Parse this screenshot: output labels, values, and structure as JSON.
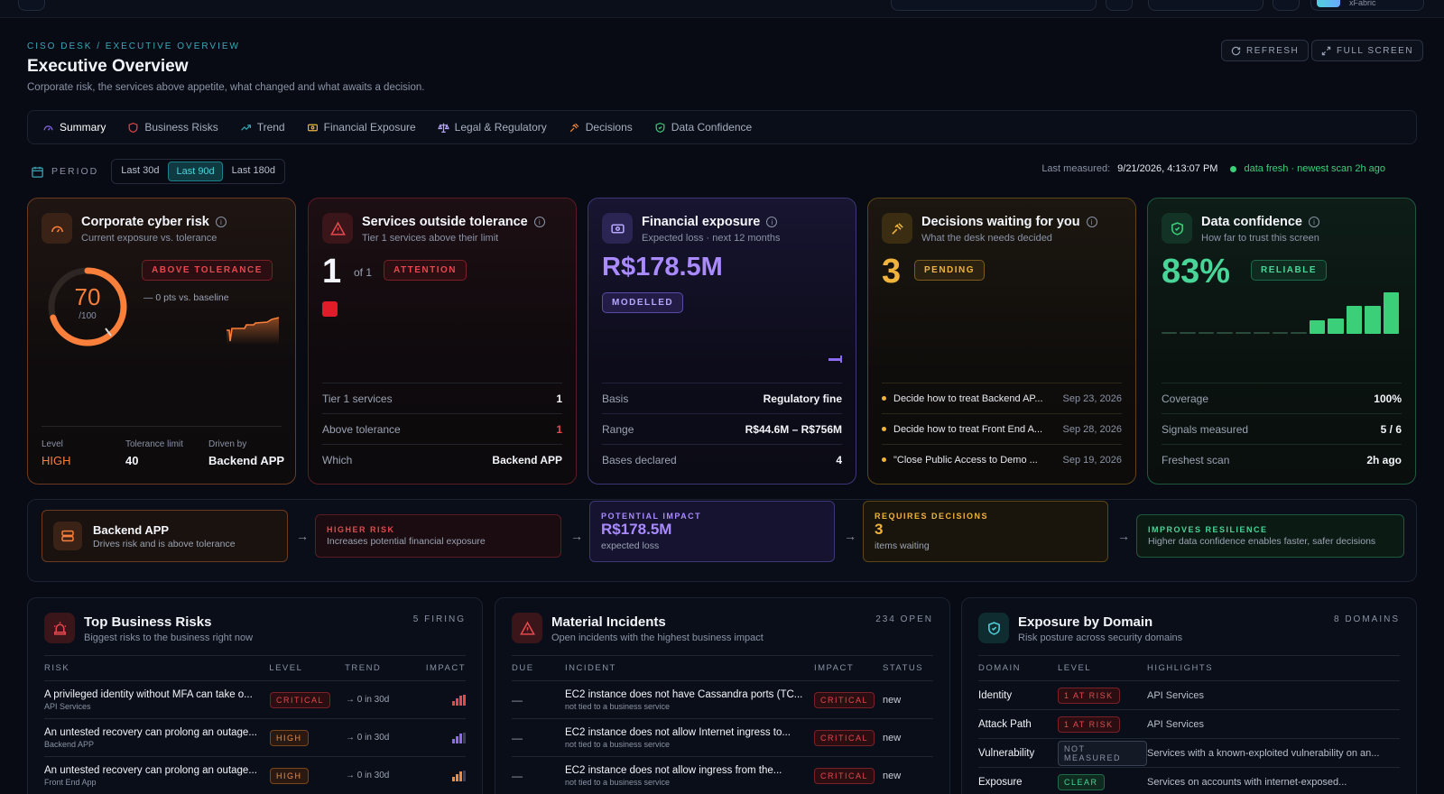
{
  "topbar": {
    "account_label": "xFabric"
  },
  "header": {
    "breadcrumb": "CISO DESK / EXECUTIVE OVERVIEW",
    "title": "Executive Overview",
    "subtitle": "Corporate risk, the services above appetite, what changed and what awaits a decision.",
    "refresh_label": "REFRESH",
    "fullscreen_label": "FULL SCREEN"
  },
  "tabs": [
    {
      "label": "Summary",
      "icon": "gauge-icon"
    },
    {
      "label": "Business Risks",
      "icon": "shield-icon"
    },
    {
      "label": "Trend",
      "icon": "trend-icon"
    },
    {
      "label": "Financial Exposure",
      "icon": "money-icon"
    },
    {
      "label": "Legal & Regulatory",
      "icon": "scales-icon"
    },
    {
      "label": "Decisions",
      "icon": "gavel-icon"
    },
    {
      "label": "Data Confidence",
      "icon": "shield-check-icon"
    }
  ],
  "period": {
    "label": "PERIOD",
    "options": [
      "Last 30d",
      "Last 90d",
      "Last 180d"
    ],
    "selected": "Last 90d"
  },
  "last_measured": {
    "label": "Last measured:",
    "value": "9/21/2026, 4:13:07 PM",
    "fresh": "data fresh · newest scan 2h ago"
  },
  "cards": {
    "risk": {
      "title": "Corporate cyber risk",
      "subtitle": "Current exposure vs. tolerance",
      "score": "70",
      "score_max": "/100",
      "score_fraction": 0.7,
      "badge": "ABOVE TOLERANCE",
      "delta": "— 0 pts vs. baseline",
      "level_label": "Level",
      "level_value": "HIGH",
      "tolerance_label": "Tolerance limit",
      "tolerance_value": "40",
      "driven_label": "Driven by",
      "driven_value": "Backend APP",
      "color": "#f97f3b"
    },
    "services": {
      "title": "Services outside tolerance",
      "subtitle": "Tier 1 services above their limit",
      "count": "1",
      "of": "of 1",
      "badge": "ATTENTION",
      "rows": [
        {
          "label": "Tier 1 services",
          "value": "1"
        },
        {
          "label": "Above tolerance",
          "value": "1"
        },
        {
          "label": "Which",
          "value": "Backend APP"
        }
      ]
    },
    "financial": {
      "title": "Financial exposure",
      "subtitle": "Expected loss · next 12 months",
      "amount": "R$178.5M",
      "badge": "MODELLED",
      "rows": [
        {
          "label": "Basis",
          "value": "Regulatory fine"
        },
        {
          "label": "Range",
          "value": "R$44.6M – R$756M"
        },
        {
          "label": "Bases declared",
          "value": "4"
        }
      ]
    },
    "decisions": {
      "title": "Decisions waiting for you",
      "subtitle": "What the desk needs decided",
      "count": "3",
      "badge": "PENDING",
      "items": [
        {
          "text": "Decide how to treat Backend AP...",
          "date": "Sep 23, 2026"
        },
        {
          "text": "Decide how to treat Front End A...",
          "date": "Sep 28, 2026"
        },
        {
          "text": "\"Close Public Access to Demo ...",
          "date": "Sep 19, 2026"
        }
      ]
    },
    "confidence": {
      "title": "Data confidence",
      "subtitle": "How far to trust this screen",
      "percent": "83%",
      "badge": "RELIABLE",
      "bars": [
        0.05,
        0.05,
        0.05,
        0.05,
        0.05,
        0.05,
        0.05,
        0.05,
        0.33,
        0.38,
        0.68,
        0.68,
        1.0
      ],
      "rows": [
        {
          "label": "Coverage",
          "value": "100%"
        },
        {
          "label": "Signals measured",
          "value": "5 / 6"
        },
        {
          "label": "Freshest scan",
          "value": "2h ago"
        }
      ]
    }
  },
  "flow": {
    "service": {
      "title": "Backend APP",
      "sub": "Drives risk and is above tolerance"
    },
    "risk": {
      "title": "HIGHER RISK",
      "sub": "Increases potential financial exposure"
    },
    "impact": {
      "title": "POTENTIAL IMPACT",
      "value": "R$178.5M",
      "sub": "expected loss"
    },
    "decisions": {
      "title": "REQUIRES DECISIONS",
      "value": "3",
      "sub": "items waiting"
    },
    "resilience": {
      "title": "IMPROVES RESILIENCE",
      "sub": "Higher data confidence enables faster, safer decisions"
    }
  },
  "panels": {
    "risks": {
      "title": "Top Business Risks",
      "subtitle": "Biggest risks to the business right now",
      "count": "5 FIRING",
      "headers": [
        "RISK",
        "LEVEL",
        "TREND",
        "IMPACT"
      ],
      "rows": [
        {
          "title": "A privileged identity without MFA can take o...",
          "sub": "API Services",
          "level": "CRITICAL",
          "trend": "→ 0 in 30d",
          "impact_color": "#e5484d"
        },
        {
          "title": "An untested recovery can prolong an outage...",
          "sub": "Backend APP",
          "level": "HIGH",
          "trend": "→ 0 in 30d",
          "impact_color": "#8b6cf0"
        },
        {
          "title": "An untested recovery can prolong an outage...",
          "sub": "Front End App",
          "level": "HIGH",
          "trend": "→ 0 in 30d",
          "impact_color": "#f08a3c"
        }
      ]
    },
    "incidents": {
      "title": "Material Incidents",
      "subtitle": "Open incidents with the highest business impact",
      "count": "234 OPEN",
      "headers": [
        "DUE",
        "INCIDENT",
        "IMPACT",
        "STATUS"
      ],
      "rows": [
        {
          "due": "—",
          "title": "EC2 instance does not have Cassandra ports (TC...",
          "sub": "not tied to a business service",
          "impact": "CRITICAL",
          "status": "new"
        },
        {
          "due": "—",
          "title": "EC2 instance does not allow Internet ingress to...",
          "sub": "not tied to a business service",
          "impact": "CRITICAL",
          "status": "new"
        },
        {
          "due": "—",
          "title": "EC2 instance does not allow ingress from the...",
          "sub": "not tied to a business service",
          "impact": "CRITICAL",
          "status": "new"
        }
      ]
    },
    "domains": {
      "title": "Exposure by Domain",
      "subtitle": "Risk posture across security domains",
      "count": "8 DOMAINS",
      "headers": [
        "DOMAIN",
        "LEVEL",
        "HIGHLIGHTS"
      ],
      "rows": [
        {
          "domain": "Identity",
          "level": "1 AT RISK",
          "kind": "crit",
          "highlight": "API Services"
        },
        {
          "domain": "Attack Path",
          "level": "1 AT RISK",
          "kind": "crit",
          "highlight": "API Services"
        },
        {
          "domain": "Vulnerability",
          "level": "NOT MEASURED",
          "kind": "nm",
          "highlight": "Services with a known-exploited vulnerability on an..."
        },
        {
          "domain": "Exposure",
          "level": "CLEAR",
          "kind": "clear",
          "highlight": "Services on accounts with internet-exposed..."
        }
      ]
    }
  }
}
